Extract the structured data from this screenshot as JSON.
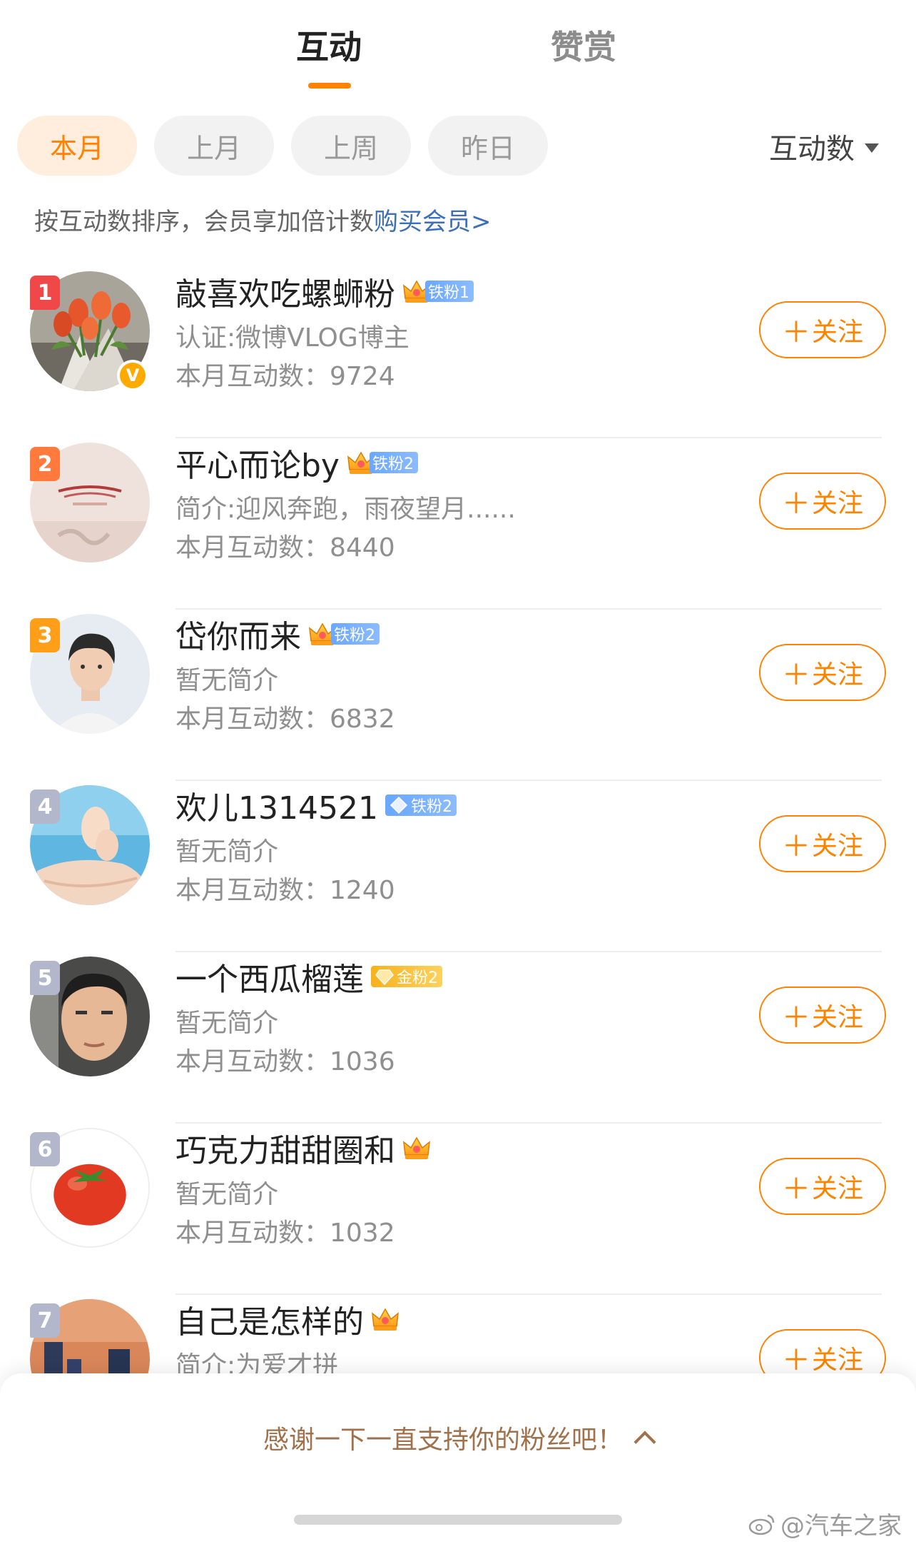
{
  "tabs": {
    "active": "互动",
    "inactive": "赞赏"
  },
  "filters": [
    "本月",
    "上月",
    "上周",
    "昨日"
  ],
  "sort_label": "互动数",
  "hint": {
    "text": "按互动数排序，会员享加倍计数",
    "link": "购买会员>"
  },
  "follow_label": "关注",
  "users": [
    {
      "rank": "1",
      "name": "敲喜欢吃螺蛳粉",
      "badge_text": "铁粉1",
      "desc": "认证:微博VLOG博主",
      "count": "本月互动数：9724"
    },
    {
      "rank": "2",
      "name": "平心而论by",
      "badge_text": "铁粉2",
      "desc": "简介:迎风奔跑，雨夜望月......",
      "count": "本月互动数：8440"
    },
    {
      "rank": "3",
      "name": "岱你而来",
      "badge_text": "铁粉2",
      "desc": "暂无简介",
      "count": "本月互动数：6832"
    },
    {
      "rank": "4",
      "name": "欢儿1314521",
      "badge_text": "铁粉2",
      "desc": "暂无简介",
      "count": "本月互动数：1240"
    },
    {
      "rank": "5",
      "name": "一个西瓜榴莲",
      "badge_text": "金粉2",
      "desc": "暂无简介",
      "count": "本月互动数：1036"
    },
    {
      "rank": "6",
      "name": "巧克力甜甜圈和",
      "badge_text": "",
      "desc": "暂无简介",
      "count": "本月互动数：1032"
    },
    {
      "rank": "7",
      "name": "自己是怎样的",
      "badge_text": "",
      "desc": "简介:为爱才拼",
      "count": ""
    }
  ],
  "colors": {
    "accent": "#ff8200",
    "rank1": "#f04848",
    "rank2": "#ff7a3c",
    "rank3": "#ff9e18",
    "rank_other": "#b3b7cc"
  },
  "sheet": {
    "text": "感谢一下一直支持你的粉丝吧！"
  },
  "watermark": "@汽车之家"
}
